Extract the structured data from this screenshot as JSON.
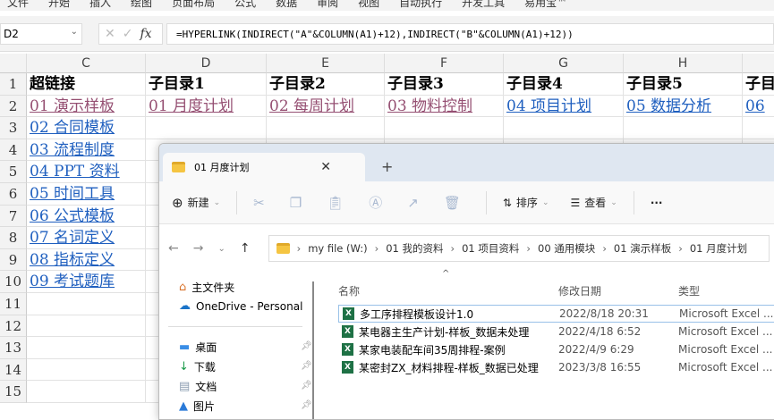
{
  "menu": [
    "文件",
    "开始",
    "插入",
    "绘图",
    "页面布局",
    "公式",
    "数据",
    "审阅",
    "视图",
    "自动执行",
    "开发工具",
    "易用宝™"
  ],
  "name_box": "D2",
  "formula": "=HYPERLINK(INDIRECT(\"A\"&COLUMN(A1)+12),INDIRECT(\"B\"&COLUMN(A1)+12))",
  "fx_label": "fx",
  "columns": [
    "C",
    "D",
    "E",
    "F",
    "G",
    "H",
    ""
  ],
  "rows": [
    "1",
    "2",
    "3",
    "4",
    "5",
    "6",
    "7",
    "8",
    "9",
    "10",
    "11",
    "12",
    "13",
    "14",
    "15"
  ],
  "row1": [
    "超链接",
    "子目录1",
    "子目录2",
    "子目录3",
    "子目录4",
    "子目录5",
    "子目"
  ],
  "row2": [
    "01 演示样板",
    "01 月度计划",
    "02 每周计划",
    "03 物料控制",
    "04 项目计划",
    "05 数据分析",
    "06"
  ],
  "col_c": [
    "02 合同模板",
    "03 流程制度",
    "04 PPT 资料",
    "05 时间工具",
    "06 公式模板",
    "07 名词定义",
    "08 指标定义",
    "09 考试题库"
  ],
  "explorer": {
    "tab_title": "01 月度计划",
    "toolbar": {
      "new": "新建",
      "sort": "排序",
      "view": "查看",
      "more": "···"
    },
    "path": [
      "my file (W:)",
      "01 我的资料",
      "01 项目资料",
      "00 通用模块",
      "01 演示样板",
      "01 月度计划"
    ],
    "sidebar": [
      {
        "label": "主文件夹"
      },
      {
        "label": "OneDrive - Personal"
      },
      {
        "label": "桌面"
      },
      {
        "label": "下载"
      },
      {
        "label": "文档"
      },
      {
        "label": "图片"
      }
    ],
    "headers": {
      "name": "名称",
      "date": "修改日期",
      "type": "类型"
    },
    "files": [
      {
        "name": "多工序排程模板设计1.0",
        "date": "2022/8/18 20:31",
        "type": "Microsoft Excel ..."
      },
      {
        "name": "某电器主生产计划-样板_数据未处理",
        "date": "2022/4/18 6:52",
        "type": "Microsoft Excel ..."
      },
      {
        "name": "某家电装配车间35周排程-案例",
        "date": "2022/4/9 6:29",
        "type": "Microsoft Excel ..."
      },
      {
        "name": "某密封ZX_材料排程-样板_数据已处理",
        "date": "2023/3/8 16:55",
        "type": "Microsoft Excel ..."
      }
    ]
  },
  "colors": {
    "link": "#1f5fbf",
    "visited": "#954f72",
    "excel": "#1e7145"
  }
}
